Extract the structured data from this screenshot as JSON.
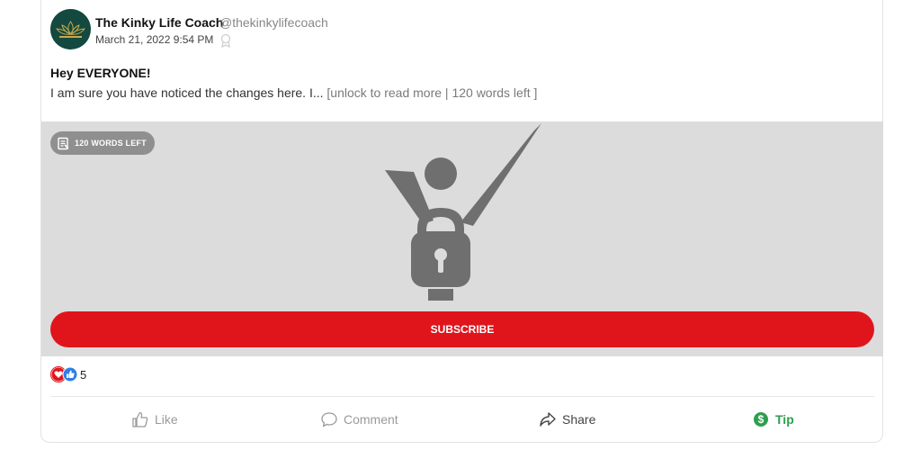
{
  "post": {
    "author_name": "The Kinky Life Coach",
    "author_handle": "@thekinkylifecoach",
    "date": "March 21, 2022 9:54 PM",
    "title": "Hey EVERYONE!",
    "excerpt": "I am sure you have noticed the changes here. I...",
    "unlock_text": "[unlock to read more | 120 words left ]"
  },
  "locked": {
    "badge_label": "120 WORDS LEFT",
    "subscribe_label": "SUBSCRIBE"
  },
  "reactions": {
    "count": "5"
  },
  "actions": {
    "like_label": "Like",
    "comment_label": "Comment",
    "share_label": "Share",
    "tip_label": "Tip"
  },
  "icons": {
    "avatar": "lotus-logo-icon",
    "verified": "ribbon-icon",
    "badge": "document-icon",
    "lock": "person-lock-icon",
    "like": "thumbs-up-icon",
    "comment": "comment-bubble-icon",
    "share": "share-arrow-icon",
    "tip": "dollar-coin-icon"
  },
  "colors": {
    "accent_red": "#e0151c",
    "tip_green": "#2e9e4f",
    "locked_bg": "#dcdcdc",
    "avatar_bg": "#14493f",
    "lock_gray": "#6f6f6f"
  }
}
